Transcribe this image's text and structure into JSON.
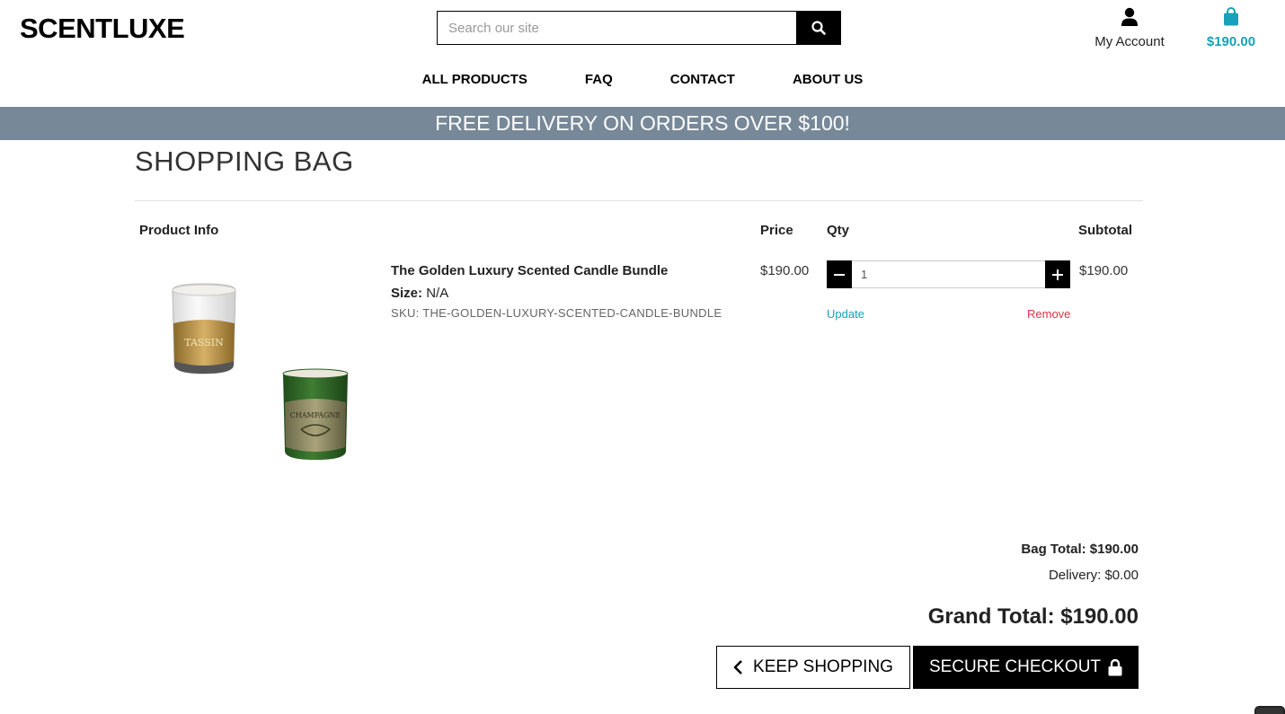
{
  "header": {
    "logo": "SCENTLUXE",
    "search_placeholder": "Search our site",
    "account_label": "My Account",
    "bag_amount": "$190.00"
  },
  "nav": {
    "items": [
      {
        "label": "ALL PRODUCTS"
      },
      {
        "label": "FAQ"
      },
      {
        "label": "CONTACT"
      },
      {
        "label": "ABOUT US"
      }
    ]
  },
  "banner": "FREE DELIVERY ON ORDERS OVER $100!",
  "bag": {
    "title": "SHOPPING BAG",
    "columns": {
      "product_info": "Product Info",
      "price": "Price",
      "qty": "Qty",
      "subtotal": "Subtotal"
    },
    "items": [
      {
        "name": "The Golden Luxury Scented Candle Bundle",
        "size_label": "Size:",
        "size_value": "N/A",
        "sku": "SKU: THE-GOLDEN-LUXURY-SCENTED-CANDLE-BUNDLE",
        "price": "$190.00",
        "qty": "1",
        "subtotal": "$190.00",
        "update_label": "Update",
        "remove_label": "Remove",
        "image_label_1": "TASSIN",
        "image_label_2": "CHAMPAGNE"
      }
    ],
    "bag_total": "Bag Total: $190.00",
    "delivery": "Delivery: $0.00",
    "grand_total": "Grand Total: $190.00",
    "keep_shopping_label": "KEEP SHOPPING",
    "checkout_label": "SECURE CHECKOUT"
  },
  "icons": {
    "search": "search-icon",
    "account": "user-icon",
    "bag": "shopping-bag-icon",
    "minus": "minus-icon",
    "plus": "plus-icon",
    "chevron": "chevron-left-icon",
    "lock": "lock-icon"
  },
  "colors": {
    "banner_bg": "#778899",
    "accent": "#17a2b8",
    "remove": "#dc3545",
    "primary": "#000000"
  }
}
